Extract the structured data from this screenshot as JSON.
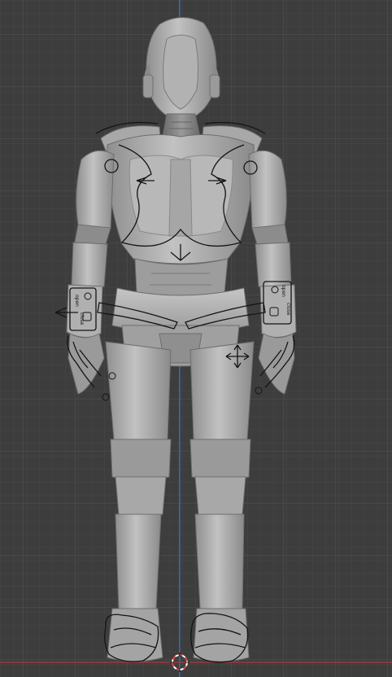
{
  "viewport": {
    "mode": "front-orthographic",
    "colors": {
      "background": "#3d3d3d",
      "grid_minor": "#474747",
      "grid_major": "#525252",
      "axis_x": "#9b3a3a",
      "axis_z": "#3b6aa6",
      "mesh_light": "#b9b9b9",
      "mesh_mid": "#9e9e9e",
      "mesh_dark": "#6e6e6e",
      "rig_line": "#141414",
      "cursor_red": "#e04444",
      "cursor_white": "#ffffff"
    }
  },
  "character": {
    "wrist_panel_left": {
      "line_1": "open",
      "line_2": "close"
    },
    "wrist_panel_right": {
      "line_1": "open",
      "line_2": "close"
    }
  },
  "icons": {
    "cursor": "3d-cursor-icon",
    "arrows": "move-arrows-icon"
  }
}
